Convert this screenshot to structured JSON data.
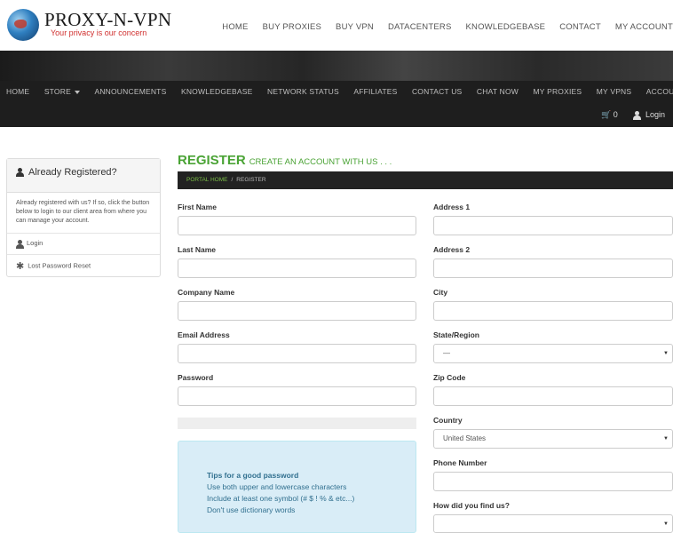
{
  "brand": {
    "title": "PROXY-N-VPN",
    "tagline": "Your privacy is our concern"
  },
  "topnav": [
    "HOME",
    "BUY PROXIES",
    "BUY VPN",
    "DATACENTERS",
    "KNOWLEDGEBASE",
    "CONTACT",
    "MY ACCOUNT"
  ],
  "mainnav": {
    "home": "HOME",
    "store": "STORE",
    "announcements": "ANNOUNCEMENTS",
    "knowledgebase": "KNOWLEDGEBASE",
    "network": "NETWORK STATUS",
    "affiliates": "AFFILIATES",
    "contact": "CONTACT US",
    "chat": "CHAT NOW",
    "proxies": "MY PROXIES",
    "vpns": "MY VPNS",
    "account": "ACCOUNT",
    "cart_count": "0",
    "login": "Login"
  },
  "sidebar": {
    "title": "Already Registered?",
    "body": "Already registered with us? If so, click the button below to login to our client area from where you can manage your account.",
    "login": "Login",
    "reset": "Lost Password Reset"
  },
  "page": {
    "title": "REGISTER",
    "subtitle": "CREATE AN ACCOUNT WITH US . . ."
  },
  "breadcrumb": {
    "home": "PORTAL HOME",
    "sep": "/",
    "current": "REGISTER"
  },
  "form": {
    "first_name": "First Name",
    "last_name": "Last Name",
    "company": "Company Name",
    "email": "Email Address",
    "password": "Password",
    "address1": "Address 1",
    "address2": "Address 2",
    "city": "City",
    "state": "State/Region",
    "state_value": "—",
    "zip": "Zip Code",
    "country": "Country",
    "country_value": "United States",
    "phone": "Phone Number",
    "howfound": "How did you find us?",
    "howfound_value": ""
  },
  "tips": {
    "title": "Tips for a good password",
    "line1": "Use both upper and lowercase characters",
    "line2": "Include at least one symbol (# $ ! % & etc...)",
    "line3": "Don't use dictionary words"
  },
  "colors": {
    "accent": "#4aa335",
    "nav_bg": "#1e1e1e",
    "tips_bg": "#d9edf7",
    "brand_red": "#d0302f"
  }
}
